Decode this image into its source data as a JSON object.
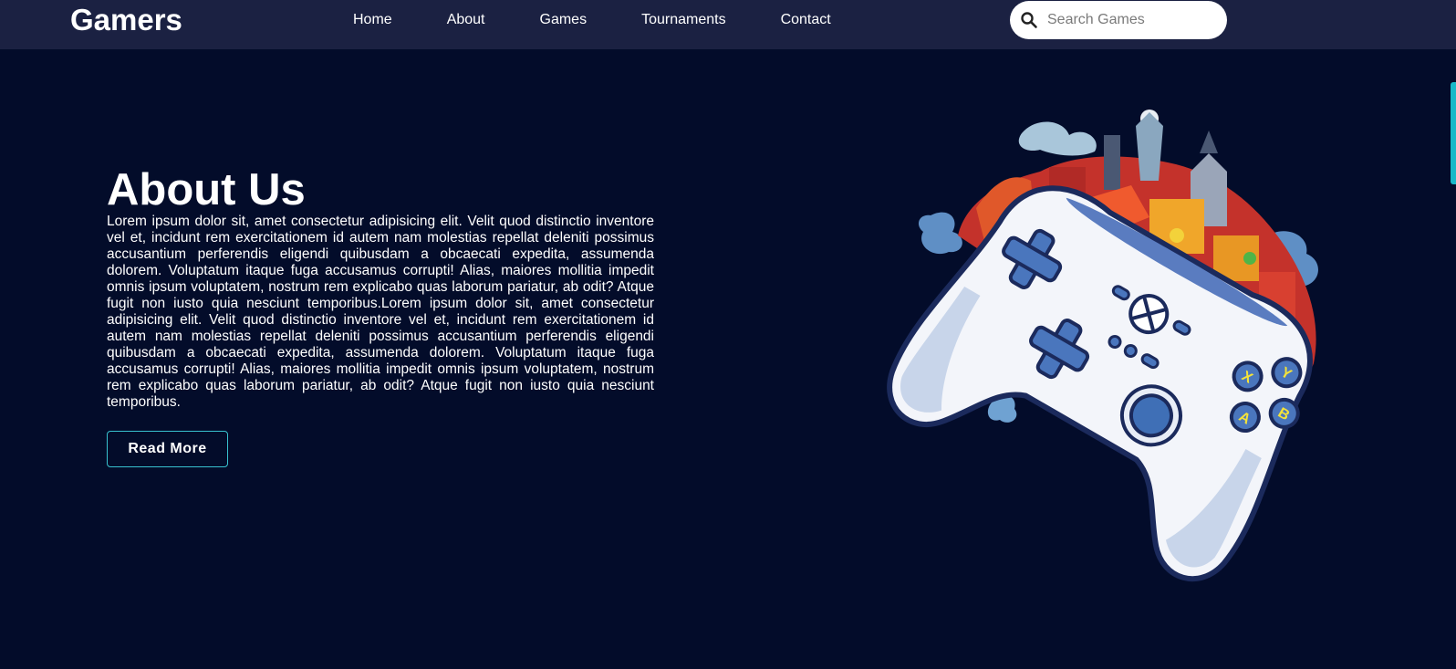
{
  "brand": {
    "name": "Gamers"
  },
  "nav": {
    "items": [
      {
        "label": "Home"
      },
      {
        "label": "About"
      },
      {
        "label": "Games"
      },
      {
        "label": "Tournaments"
      },
      {
        "label": "Contact"
      }
    ]
  },
  "search": {
    "placeholder": "Search Games",
    "icon": "search-icon"
  },
  "about": {
    "title": "About Us",
    "body": "Lorem ipsum dolor sit, amet consectetur adipisicing elit. Velit quod distinctio inventore vel et, incidunt rem exercitationem id autem nam molestias repellat deleniti possimus accusantium perferendis eligendi quibusdam a obcaecati expedita, assumenda dolorem. Voluptatum itaque fuga accusamus corrupti! Alias, maiores mollitia impedit omnis ipsum voluptatem, nostrum rem explicabo quas laborum pariatur, ab odit? Atque fugit non iusto quia nesciunt temporibus.Lorem ipsum dolor sit, amet consectetur adipisicing elit. Velit quod distinctio inventore vel et, incidunt rem exercitationem id autem nam molestias repellat deleniti possimus accusantium perferendis eligendi quibusdam a obcaecati expedita, assumenda dolorem. Voluptatum itaque fuga accusamus corrupti! Alias, maiores mollitia impedit omnis ipsum voluptatem, nostrum rem explicabo quas laborum pariatur, ab odit? Atque fugit non iusto quia nesciunt temporibus.",
    "button_label": "Read More"
  },
  "controller": {
    "buttons": [
      "X",
      "Y",
      "A",
      "B"
    ]
  },
  "colors": {
    "background": "#030c2a",
    "navbar": "#1b2142",
    "accent": "#38c2cf",
    "scroll_indicator": "#18b8c8"
  }
}
